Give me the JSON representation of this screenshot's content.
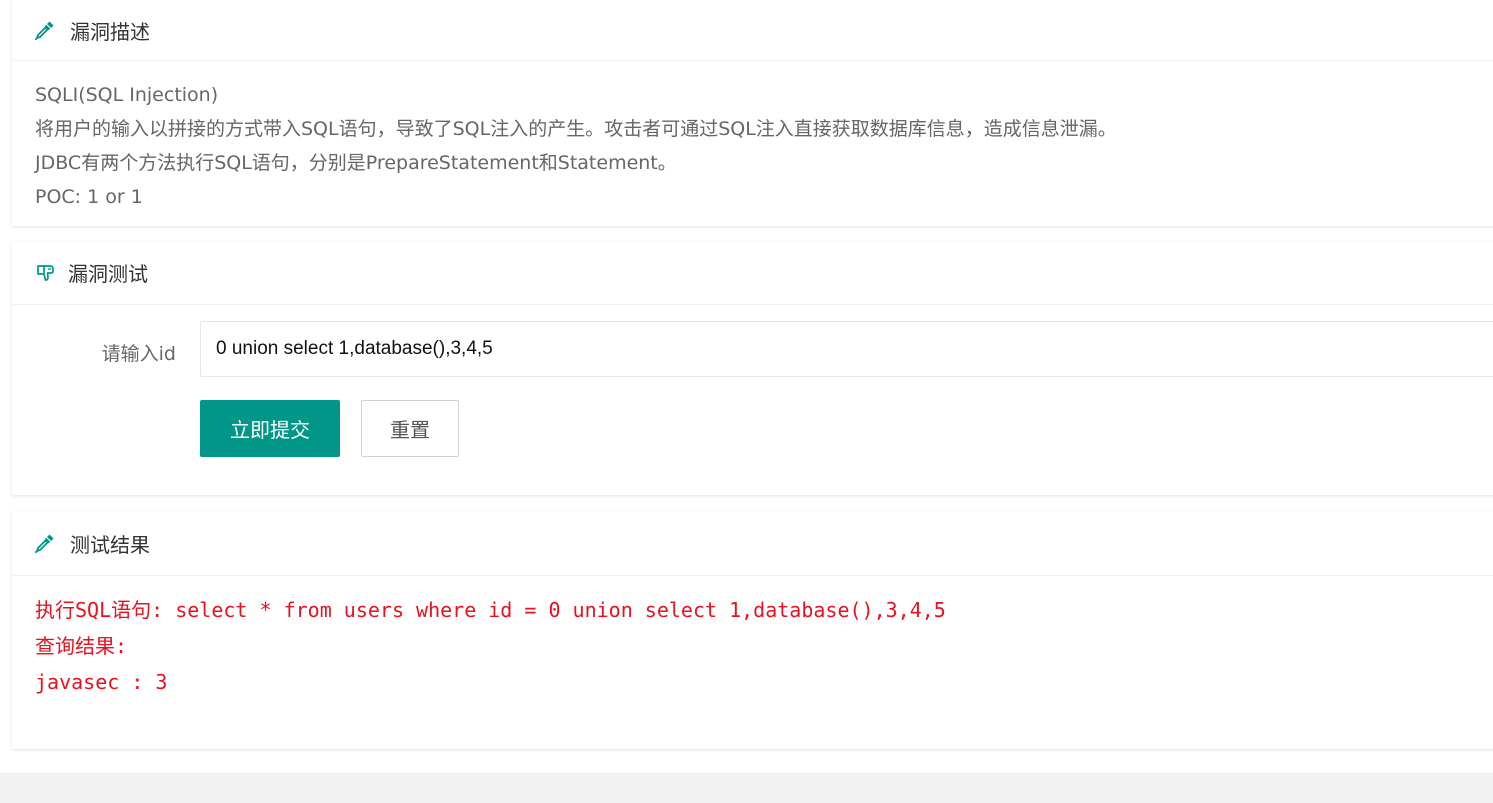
{
  "theme": {
    "accent": "#009688",
    "result_color": "#e6121f"
  },
  "description": {
    "title": "漏洞描述",
    "icon": "eyedropper-icon",
    "lines": [
      "SQLI(SQL Injection)",
      "将用户的输入以拼接的方式带入SQL语句，导致了SQL注入的产生。攻击者可通过SQL注入直接获取数据库信息，造成信息泄漏。",
      "JDBC有两个方法执行SQL语句，分别是PrepareStatement和Statement。",
      "POC: 1 or 1"
    ]
  },
  "test": {
    "title": "漏洞测试",
    "icon": "dislike-hand-icon",
    "label": "请输入id",
    "input_value": "0 union select 1,database(),3,4,5",
    "submit_label": "立即提交",
    "reset_label": "重置"
  },
  "result": {
    "title": "测试结果",
    "icon": "eyedropper-icon",
    "sql_line": "执行SQL语句: select * from users where id = 0 union select 1,database(),3,4,5",
    "query_label": "查询结果:",
    "output": "javasec : 3"
  }
}
